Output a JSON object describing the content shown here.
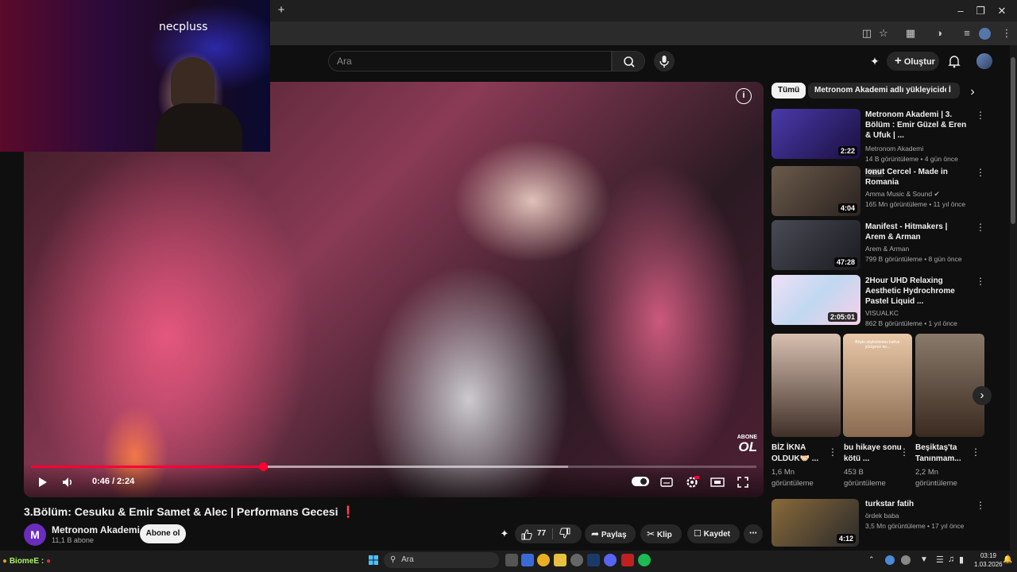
{
  "browser": {
    "new_tab_icon": "plus-icon",
    "window_controls": [
      "minimize-icon",
      "restore-icon",
      "close-icon"
    ]
  },
  "header": {
    "search_placeholder": "Ara",
    "create_label": "Oluştur"
  },
  "webcam": {
    "streamer_name": "necpluss"
  },
  "player": {
    "time": "0:46 / 2:24",
    "progress_fraction": 0.32,
    "buffer_fraction": 0.74,
    "watermark_top": "ABONE",
    "watermark_bottom": "OL"
  },
  "video": {
    "title": "3.Bölüm: Cesuku & Emir Samet & Alec | Performans Gecesi",
    "title_emoji": "❗",
    "channel_name": "Metronom Akademi",
    "channel_initial": "M",
    "subscribers": "11,1 B abone",
    "subscribe_label": "Abone ol",
    "likes": "77",
    "share_label": "Paylaş",
    "clip_label": "Klip",
    "save_label": "Kaydet"
  },
  "sidebar": {
    "chips": [
      "Tümü",
      "Metronom Akademi adlı yükleyiciden",
      "İ"
    ],
    "recommendations": [
      {
        "title": "Metronom Akademi | 3. Bölüm : Emir Güzel & Eren & Ufuk | ...",
        "channel": "Metronom Akademi",
        "meta": "14 B görüntüleme • 4 gün önce",
        "badge": "Yeni",
        "duration": "2:22",
        "thumb_color": "#2a1a6a"
      },
      {
        "title": "Ionut Cercel - Made in Romania",
        "channel": "Amma Music & Sound",
        "meta": "165 Mn görüntüleme • 11 yıl önce",
        "badge": "",
        "duration": "4:04",
        "thumb_color": "#5a4a3a"
      },
      {
        "title": "Manifest - Hitmakers | Arem & Arman",
        "channel": "Arem & Arman",
        "meta": "799 B görüntüleme • 8 gün önce",
        "badge": "",
        "duration": "47:28",
        "thumb_color": "#3a3a40"
      },
      {
        "title": "2Hour UHD Relaxing Aesthetic Hydrochrome  Pastel Liquid  ...",
        "channel": "VISUALKC",
        "meta": "862 B görüntüleme • 1 yıl önce",
        "badge": "",
        "duration": "2:05:01",
        "thumb_color": "#d8c8e8"
      }
    ],
    "shorts": [
      {
        "title": "BİZ İKNA OLDUK🤝🏻 ...",
        "views": "1,6 Mn görüntüleme",
        "thumb_color": "#c0a090"
      },
      {
        "title": "bu hikaye sonu kötü ...",
        "views": "453 B görüntüleme",
        "thumb_color": "#d8b898"
      },
      {
        "title": "Beşiktaş'ta Tanınmam...",
        "views": "2,2 Mn görüntüleme",
        "thumb_color": "#6a5a4a"
      }
    ],
    "short_caption": "Böyle söylesinmez kahve yürüyece ne...",
    "last_item": {
      "title": "turkstar fatih",
      "channel": "ördek baba",
      "meta": "3,5 Mn görüntüleme • 17 yıl önce",
      "duration": "4:12"
    }
  },
  "taskbar": {
    "overlay_text": "BiomeE :",
    "search_label": "Ara",
    "clock_time": "03:19",
    "clock_date": "1.03.2026"
  }
}
